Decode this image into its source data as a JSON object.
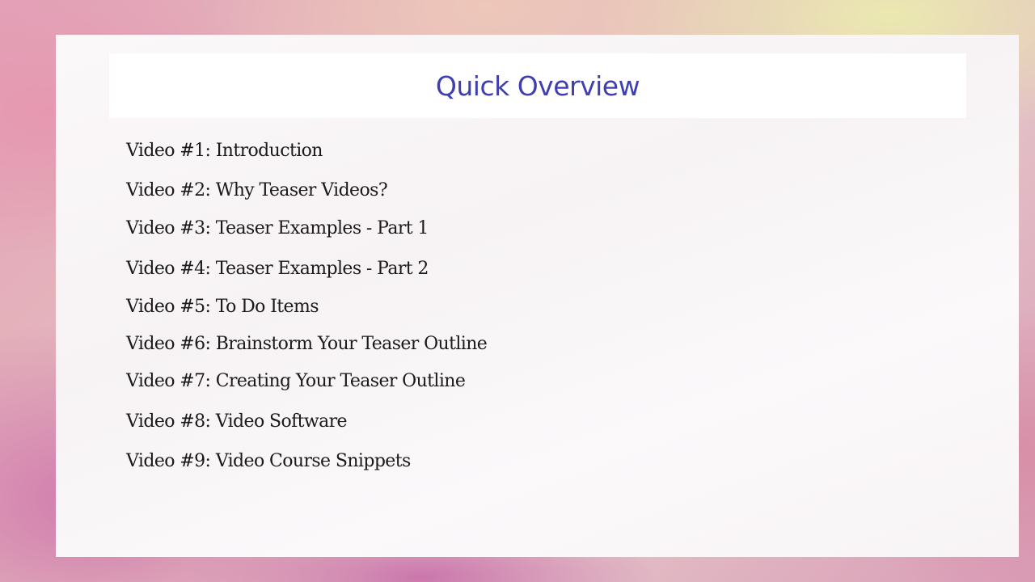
{
  "slide": {
    "title": "Quick Overview",
    "items": [
      "Video #1: Introduction",
      "Video #2:  Why Teaser Videos?",
      "Video #3: Teaser Examples - Part 1",
      "Video #4: Teaser Examples - Part 2",
      "Video #5: To Do Items",
      "Video #6: Brainstorm Your Teaser Outline",
      "Video #7: Creating Your Teaser Outline",
      "Video #8: Video Software",
      "Video #9: Video Course Snippets"
    ]
  },
  "colors": {
    "title": "#3f3fb0",
    "text": "#1a1a1a",
    "card": "#f9f6f7"
  }
}
